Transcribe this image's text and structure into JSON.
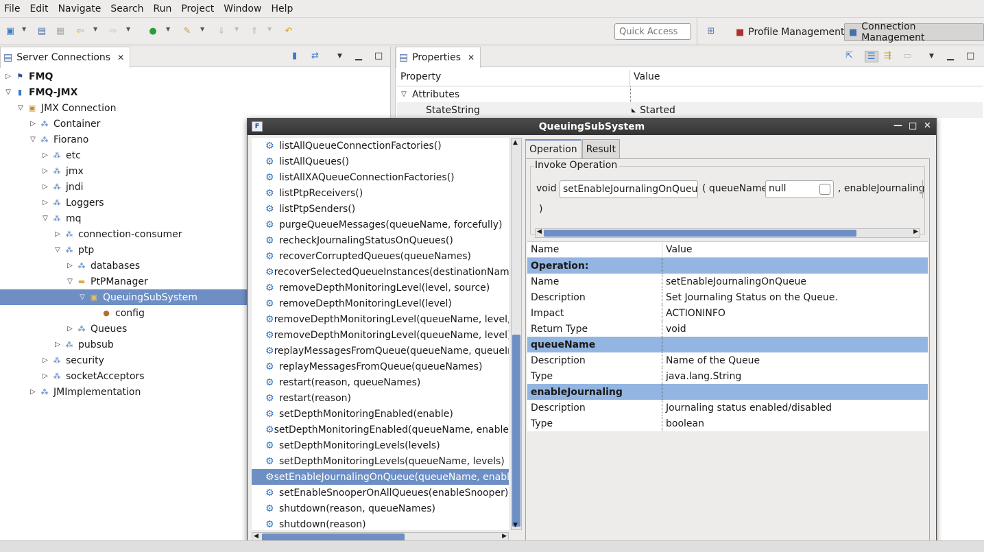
{
  "menu": [
    "File",
    "Edit",
    "Navigate",
    "Search",
    "Run",
    "Project",
    "Window",
    "Help"
  ],
  "toolbar": {
    "quick_access_placeholder": "Quick Access",
    "perspectives": [
      "Profile Management",
      "Connection Management"
    ]
  },
  "server_connections": {
    "tab_label": "Server Connections",
    "tree": [
      {
        "label": "FMQ",
        "depth": 0,
        "expanded": false,
        "bold": true
      },
      {
        "label": "FMQ-JMX",
        "depth": 0,
        "expanded": true,
        "bold": true
      },
      {
        "label": "JMX Connection",
        "depth": 1,
        "expanded": true
      },
      {
        "label": "Container",
        "depth": 2,
        "expanded": false
      },
      {
        "label": "Fiorano",
        "depth": 2,
        "expanded": true
      },
      {
        "label": "etc",
        "depth": 3,
        "expanded": false
      },
      {
        "label": "jmx",
        "depth": 3,
        "expanded": false
      },
      {
        "label": "jndi",
        "depth": 3,
        "expanded": false
      },
      {
        "label": "Loggers",
        "depth": 3,
        "expanded": false
      },
      {
        "label": "mq",
        "depth": 3,
        "expanded": true
      },
      {
        "label": "connection-consumer",
        "depth": 4,
        "expanded": false
      },
      {
        "label": "ptp",
        "depth": 4,
        "expanded": true
      },
      {
        "label": "databases",
        "depth": 5,
        "expanded": false
      },
      {
        "label": "PtPManager",
        "depth": 5,
        "expanded": true
      },
      {
        "label": "QueuingSubSystem",
        "depth": 6,
        "expanded": true,
        "selected": true
      },
      {
        "label": "config",
        "depth": 7,
        "leaf": true
      },
      {
        "label": "Queues",
        "depth": 5,
        "expanded": false
      },
      {
        "label": "pubsub",
        "depth": 4,
        "expanded": false
      },
      {
        "label": "security",
        "depth": 3,
        "expanded": false
      },
      {
        "label": "socketAcceptors",
        "depth": 3,
        "expanded": false
      },
      {
        "label": "JMImplementation",
        "depth": 2,
        "expanded": false
      }
    ]
  },
  "properties": {
    "tab_label": "Properties",
    "col_property": "Property",
    "col_value": "Value",
    "rows": [
      {
        "property": "Attributes",
        "value": "",
        "group": true
      },
      {
        "property": "StateString",
        "value": "Started",
        "group": false
      }
    ]
  },
  "dialog": {
    "title": "QueuingSubSystem",
    "operations": [
      "listAllQueueConnectionFactories()",
      "listAllQueues()",
      "listAllXAQueueConnectionFactories()",
      "listPtpReceivers()",
      "listPtpSenders()",
      "purgeQueueMessages(queueName, forcefully)",
      "recheckJournalingStatusOnQueues()",
      "recoverCorruptedQueues(queueNames)",
      "recoverSelectedQueueInstances(destinationName,",
      "removeDepthMonitoringLevel(level, source)",
      "removeDepthMonitoringLevel(level)",
      "removeDepthMonitoringLevel(queueName, level, so",
      "removeDepthMonitoringLevel(queueName, level)",
      "replayMessagesFromQueue(queueName, queueInst",
      "replayMessagesFromQueue(queueNames)",
      "restart(reason, queueNames)",
      "restart(reason)",
      "setDepthMonitoringEnabled(enable)",
      "setDepthMonitoringEnabled(queueName, enabled)",
      "setDepthMonitoringLevels(levels)",
      "setDepthMonitoringLevels(queueName, levels)",
      "setEnableJournalingOnQueue(queueName, enableJo",
      "setEnableSnooperOnAllQueues(enableSnooper)",
      "shutdown(reason, queueNames)",
      "shutdown(reason)"
    ],
    "selected_operation_index": 21,
    "tabs": [
      "Operation",
      "Result"
    ],
    "invoke": {
      "legend": "Invoke Operation",
      "return_type": "void",
      "method_name": "setEnableJournalingOnQueue",
      "open_paren": "( queueName",
      "param1_value": "null",
      "param2_label": ", enableJournaling",
      "close_paren": ")"
    },
    "info": {
      "col_name": "Name",
      "col_value": "Value",
      "rows": [
        {
          "name": "Operation:",
          "value": "",
          "section": true
        },
        {
          "name": "Name",
          "value": "setEnableJournalingOnQueue"
        },
        {
          "name": "Description",
          "value": "Set Journaling Status on the Queue."
        },
        {
          "name": "Impact",
          "value": "ACTIONINFO"
        },
        {
          "name": "Return Type",
          "value": "void"
        },
        {
          "name": "queueName",
          "value": "",
          "section": true
        },
        {
          "name": "Description",
          "value": "Name of the Queue"
        },
        {
          "name": "Type",
          "value": "java.lang.String"
        },
        {
          "name": "enableJournaling",
          "value": "",
          "section": true
        },
        {
          "name": "Description",
          "value": "Journaling status enabled/disabled"
        },
        {
          "name": "Type",
          "value": "boolean"
        }
      ]
    }
  }
}
